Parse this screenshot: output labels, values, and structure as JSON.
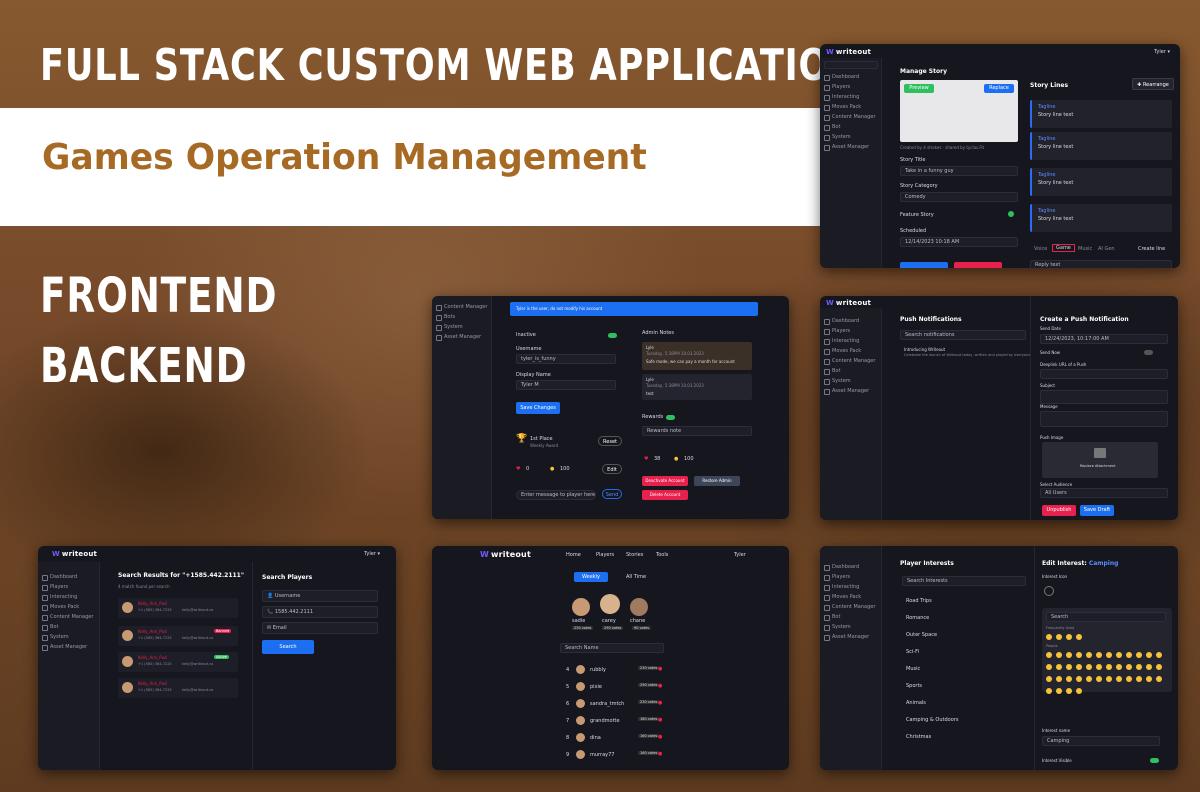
{
  "banner": {
    "title": "FULL STACK CUSTOM WEB APPLICATION",
    "subtitle": "Games Operation Management",
    "frontend": "FRONTEND",
    "backend": "BACKEND"
  },
  "colors": {
    "accent_blue": "#1d6ff2",
    "accent_red": "#e8204d",
    "brand_orange": "#a66a25",
    "panel_dark": "#16161e"
  },
  "app": {
    "logo_text": "writeout",
    "user_menu": "Tyler ▾"
  },
  "sidebar": [
    "Dashboard",
    "Players",
    "Interacting",
    "Moves Pack",
    "Content Manager",
    "Bot",
    "System",
    "Asset Manager"
  ],
  "manage_story": {
    "heading": "Manage Story",
    "preview_left_btn": "Preview",
    "preview_right_btn": "Replace",
    "meta": "Created by 4 strokes · shared by tyclas.Fit",
    "story_title_label": "Story Title",
    "story_title_value": "Take in a funny guy",
    "category_label": "Story Category",
    "category_value": "Comedy",
    "feature_label": "Feature Story",
    "schedule_label": "Scheduled",
    "schedule_value": "12/14/2023 10:18 AM",
    "story_lines_heading": "Story Lines",
    "rearrange_btn": "Rearrange",
    "lines": [
      {
        "name": "Tagline",
        "text": "Story line text"
      },
      {
        "name": "Tagline",
        "text": "Story line text"
      },
      {
        "name": "Tagline",
        "text": "Story line text"
      },
      {
        "name": "Tagline",
        "text": "Story line text"
      }
    ],
    "tabs": [
      "Voice",
      "Game",
      "Music",
      "AI Gen"
    ],
    "create_line": "Create line",
    "bottom_input": "Reply text"
  },
  "player_edit": {
    "banner": "Tyler is the user, do not modify his account",
    "sidebar": [
      "Content Manager",
      "Bots",
      "System",
      "Asset Manager"
    ],
    "inactive_label": "Inactive",
    "username_label": "Username",
    "username_value": "tyler_is_funny",
    "display_label": "Display Name",
    "display_value": "Tyler M",
    "save_btn": "Save Changes",
    "admin_notes": "Admin Notes",
    "notes": [
      {
        "author": "Lyle",
        "date": "Tuesday, 5:38PM 10.03.2023",
        "text": "Safe mode, we can pay a month for account"
      },
      {
        "author": "Lyle",
        "date": "Tuesday, 5:38PM 10.03.2023",
        "text": "test"
      }
    ],
    "place_title": "1st Place",
    "place_sub": "Weekly Award",
    "reset_btn": "Reset",
    "counters": [
      "0",
      "100"
    ],
    "edit_btn": "Edit",
    "message_placeholder": "Enter message to player here",
    "send_btn": "Send",
    "rewards_label": "Rewards",
    "rewards_input": "Rewards note",
    "hearts": "38",
    "coins": "100",
    "deactivate_btn": "Deactivate Account",
    "restore_btn": "Restore Admin",
    "delete_btn": "Delete Account"
  },
  "push": {
    "heading": "Push Notifications",
    "search_placeholder": "Search notifications",
    "item_title": "Introducing Writeout",
    "item_text": "Celebrate the launch of Writeout today, written and played by everyone",
    "create_heading": "Create a Push Notification",
    "send_date_label": "Send Date",
    "send_date_value": "12/24/2023, 10:17:00 AM",
    "send_now_label": "Send Now",
    "open_label": "Deeplink URL of a Push",
    "subject_label": "Subject",
    "message_label": "Message",
    "image_label": "Push Image",
    "upload_btn": "Replace Attachment",
    "audience_label": "Select Audience",
    "audience_value": "All Users",
    "cancel_btn": "Unpublish",
    "save_btn": "Save Draft"
  },
  "search": {
    "heading": "Search Results for \"+1585.442.2111\"",
    "sub": "4 match found per search",
    "results": [
      {
        "name": "Kelly_Ann_Pud",
        "phone": "+1 (585) 384-7225",
        "email": "kelly@writeout.co",
        "tag": ""
      },
      {
        "name": "Kelly_Ann_Pud",
        "phone": "+1 (585) 384-7225",
        "email": "kelly@writeout.co",
        "tag": "Banned"
      },
      {
        "name": "Kelly_Ann_Pud",
        "phone": "+1 (585) 384-7225",
        "email": "kelly@writeout.co",
        "tag": "Active"
      },
      {
        "name": "Kelly_Ann_Pud",
        "phone": "+1 (585) 384-7225",
        "email": "kelly@writeout.co",
        "tag": ""
      }
    ],
    "panel_heading": "Search Players",
    "fields": [
      "Username",
      "1585.442.2111",
      "Email"
    ],
    "search_btn": "Search"
  },
  "leaderboard": {
    "nav": [
      "Home",
      "Players",
      "Stories",
      "Tools"
    ],
    "user": "Tyler",
    "tabs": [
      "Weekly",
      "All Time"
    ],
    "podium": [
      {
        "name": "sadie",
        "score": "230 votes"
      },
      {
        "name": "carey",
        "score": "290 votes"
      },
      {
        "name": "chane",
        "score": "90 votes"
      }
    ],
    "search_placeholder": "Search Name",
    "rows": [
      {
        "rank": "4",
        "name": "rubbly",
        "score": "230 votes"
      },
      {
        "rank": "5",
        "name": "pixie",
        "score": "290 votes"
      },
      {
        "rank": "6",
        "name": "sandra_tmtch",
        "score": "230 votes"
      },
      {
        "rank": "7",
        "name": "grandmotte",
        "score": "180 votes"
      },
      {
        "rank": "8",
        "name": "dina",
        "score": "160 votes"
      },
      {
        "rank": "9",
        "name": "murray77",
        "score": "160 votes"
      }
    ]
  },
  "interests": {
    "heading": "Player Interests",
    "search_placeholder": "Search Interests",
    "items": [
      "Road Trips",
      "Romance",
      "Outer Space",
      "Sci-Fi",
      "Music",
      "Sports",
      "Animals",
      "Camping & Outdoors",
      "Christmas"
    ],
    "edit_heading": "Edit Interest:",
    "edit_value": "Camping",
    "icon_label": "Interest Icon",
    "emoji_search": "Search",
    "freq_label": "Frequently Used",
    "people_label": "People",
    "name_label": "Interest name",
    "name_value": "Camping",
    "visible_label": "Interest Visible"
  }
}
